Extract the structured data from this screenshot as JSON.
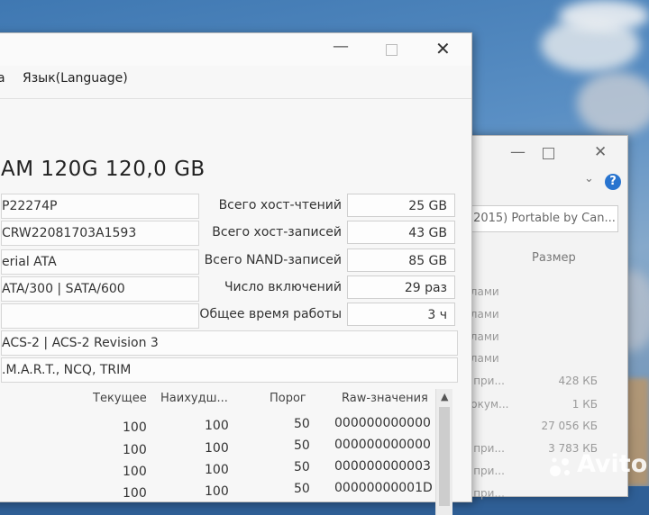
{
  "front_window": {
    "menu": {
      "partial_item": "а",
      "language_item": "Язык(Language)"
    },
    "title_visible": "AM 120G 120,0 GB",
    "left_fields": [
      "P22274P",
      "CRW22081703A1593",
      "erial ATA",
      "ATA/300 | SATA/600",
      ""
    ],
    "standard_field": "ACS-2 | ACS-2 Revision 3",
    "features_field": ".M.A.R.T., NCQ, TRIM",
    "stats": [
      {
        "label": "Всего хост-чтений",
        "value": "25 GB"
      },
      {
        "label": "Всего хост-записей",
        "value": "43 GB"
      },
      {
        "label": "Всего NAND-записей",
        "value": "85 GB"
      },
      {
        "label": "Число включений",
        "value": "29 раз"
      },
      {
        "label": "Общее время работы",
        "value": "3 ч"
      }
    ],
    "smart_headers": {
      "current": "Текущее",
      "worst": "Наихудш...",
      "threshold": "Порог",
      "raw": "Raw-значения"
    },
    "smart_rows": [
      {
        "current": "100",
        "worst": "100",
        "threshold": "50",
        "raw": "000000000000"
      },
      {
        "current": "100",
        "worst": "100",
        "threshold": "50",
        "raw": "000000000000"
      },
      {
        "current": "100",
        "worst": "100",
        "threshold": "50",
        "raw": "000000000003"
      },
      {
        "current": "100",
        "worst": "100",
        "threshold": "50",
        "raw": "00000000001D"
      }
    ]
  },
  "back_window": {
    "path": "(2015) Portable by Can...",
    "size_header": "Размер",
    "rows": [
      {
        "text": "йлами",
        "size": ""
      },
      {
        "text": "йлами",
        "size": ""
      },
      {
        "text": "йлами",
        "size": ""
      },
      {
        "text": "йлами",
        "size": ""
      },
      {
        "text": "е при...",
        "size": "428 КБ"
      },
      {
        "text": "докум...",
        "size": "1 КБ"
      },
      {
        "text": "",
        "size": "27 056 КБ"
      },
      {
        "text": "е при...",
        "size": "3 783 КБ"
      },
      {
        "text": "е при...",
        "size": ""
      },
      {
        "text": "е при...",
        "size": ""
      }
    ]
  },
  "watermark": "Avito"
}
